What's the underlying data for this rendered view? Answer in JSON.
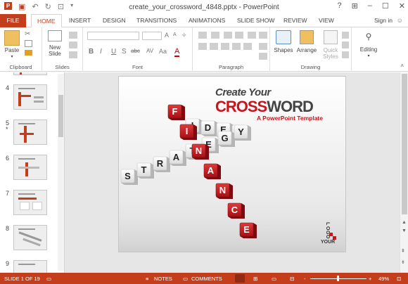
{
  "window": {
    "title": "create_your_crossword_4848.pptx - PowerPoint",
    "help": "?",
    "sign_in": "Sign in"
  },
  "tabs": [
    "FILE",
    "HOME",
    "INSERT",
    "DESIGN",
    "TRANSITIONS",
    "ANIMATIONS",
    "SLIDE SHOW",
    "REVIEW",
    "VIEW"
  ],
  "ribbon": {
    "groups": [
      "Clipboard",
      "Slides",
      "Font",
      "Paragraph",
      "Drawing",
      "Editing"
    ],
    "paste": "Paste",
    "new_slide_1": "New",
    "new_slide_2": "Slide",
    "shapes": "Shapes",
    "arrange": "Arrange",
    "quick_styles_1": "Quick",
    "quick_styles_2": "Styles",
    "editing": "Editing",
    "font_buttons": [
      "B",
      "I",
      "U",
      "S",
      "abc",
      "AV",
      "Aa",
      "A"
    ]
  },
  "thumbnails": [
    {
      "num": "4",
      "marker": ""
    },
    {
      "num": "5",
      "marker": "*"
    },
    {
      "num": "6",
      "marker": ""
    },
    {
      "num": "7",
      "marker": ""
    },
    {
      "num": "8",
      "marker": ""
    },
    {
      "num": "9",
      "marker": ""
    }
  ],
  "slide": {
    "title_top": "Create Your",
    "title_red": "CROSS",
    "title_dark": "WORD",
    "subtitle": "A PowerPoint Template",
    "logo_letters": [
      "L",
      "O",
      "G",
      "O"
    ],
    "logo_your": "YOUR",
    "words": {
      "finance": [
        "F",
        "I",
        "N",
        "A",
        "N",
        "C",
        "E"
      ],
      "idea": [
        "I",
        "D",
        "E",
        "A"
      ],
      "strategy": [
        "S",
        "T",
        "R",
        "A",
        "T",
        "E",
        "G",
        "Y"
      ]
    }
  },
  "status": {
    "slide_of": "SLIDE 1 OF 19",
    "notes": "NOTES",
    "comments": "COMMENTS",
    "zoom": "49%",
    "zoom_minus": "-",
    "zoom_plus": "+"
  },
  "colors": {
    "accent": "#c43e1c",
    "tile_red": "#c8151d"
  }
}
